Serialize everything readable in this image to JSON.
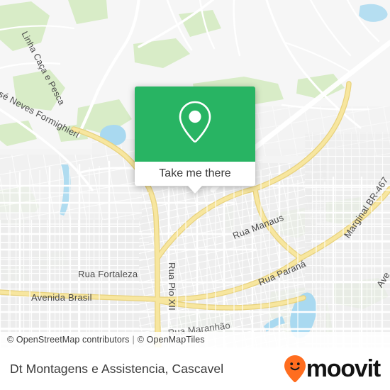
{
  "map": {
    "provider_style": "openmaptiles-osm-light",
    "colors": {
      "land": "#f2f2f2",
      "road_minor": "#ffffff",
      "road_arterial": "#f5e199",
      "park": "#d6ecc8",
      "water": "#a8d8ef",
      "building": "#e8e8e8",
      "label": "#4a4a4a"
    },
    "street_labels": [
      {
        "name": "Linha Caça e Pesca",
        "text": "Linha Caça e Pesca"
      },
      {
        "name": "José Neves Formighieri",
        "text": "José Neves Formighieri"
      },
      {
        "name": "Rua Fortaleza",
        "text": "Rua Fortaleza"
      },
      {
        "name": "Avenida Brasil",
        "text": "Avenida Brasil"
      },
      {
        "name": "Rua Pio XII",
        "text": "Rua Pio XII"
      },
      {
        "name": "Rua Manaus",
        "text": "Rua Manaus"
      },
      {
        "name": "Rua Paraná",
        "text": "Rua Paraná"
      },
      {
        "name": "Marginal BR-467",
        "text": "Marginal BR-467"
      },
      {
        "name": "Rua Maranhão",
        "text": "Rua Maranhão"
      },
      {
        "name": "Ave",
        "text": "Ave"
      }
    ]
  },
  "popup": {
    "cta_label": "Take me there",
    "marker_icon": "map-pin-icon",
    "header_color": "#28b463"
  },
  "attribution": {
    "osm": "© OpenStreetMap contributors",
    "separator": "|",
    "tiles": "© OpenMapTiles"
  },
  "footer": {
    "title": "Dt Montagens e Assistencia, Cascavel",
    "brand_name": "moovit",
    "brand_icon": "moovit-smiley-pin-icon",
    "brand_accent": "#ff6d1f"
  }
}
